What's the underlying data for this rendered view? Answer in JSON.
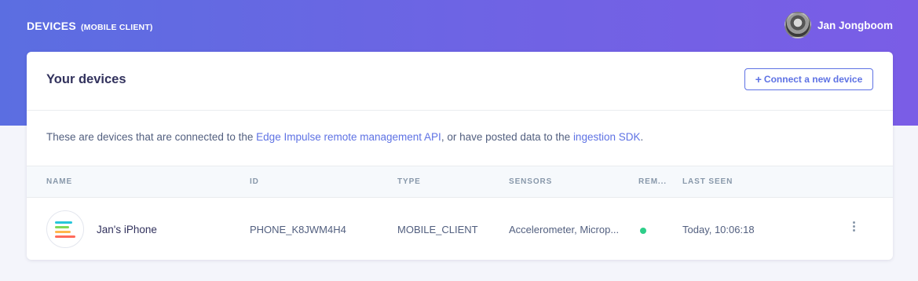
{
  "header": {
    "title": "DEVICES",
    "subtitle": "(MOBILE CLIENT)",
    "user_name": "Jan Jongboom"
  },
  "card": {
    "title": "Your devices",
    "connect_button": "Connect a new device",
    "description": {
      "part1": "These are devices that are connected to the ",
      "link1": "Edge Impulse remote management API",
      "part2": ", or have posted data to the ",
      "link2": "ingestion SDK",
      "part3": "."
    }
  },
  "table": {
    "columns": {
      "name": "NAME",
      "id": "ID",
      "type": "TYPE",
      "sensors": "SENSORS",
      "remote": "REM...",
      "last_seen": "LAST SEEN"
    },
    "rows": [
      {
        "name": "Jan's iPhone",
        "id": "PHONE_K8JWM4H4",
        "type": "MOBILE_CLIENT",
        "sensors": "Accelerometer, Microp...",
        "remote_connected": true,
        "last_seen": "Today, 10:06:18"
      }
    ]
  },
  "colors": {
    "accent": "#5e72e4",
    "status_online": "#2dce89",
    "icon_bars": [
      "#26c6da",
      "#7ed957",
      "#ff6b5b"
    ]
  },
  "icons": {
    "plus": "plus-icon",
    "kebab": "more-vertical-icon",
    "device": "device-logo-icon"
  }
}
